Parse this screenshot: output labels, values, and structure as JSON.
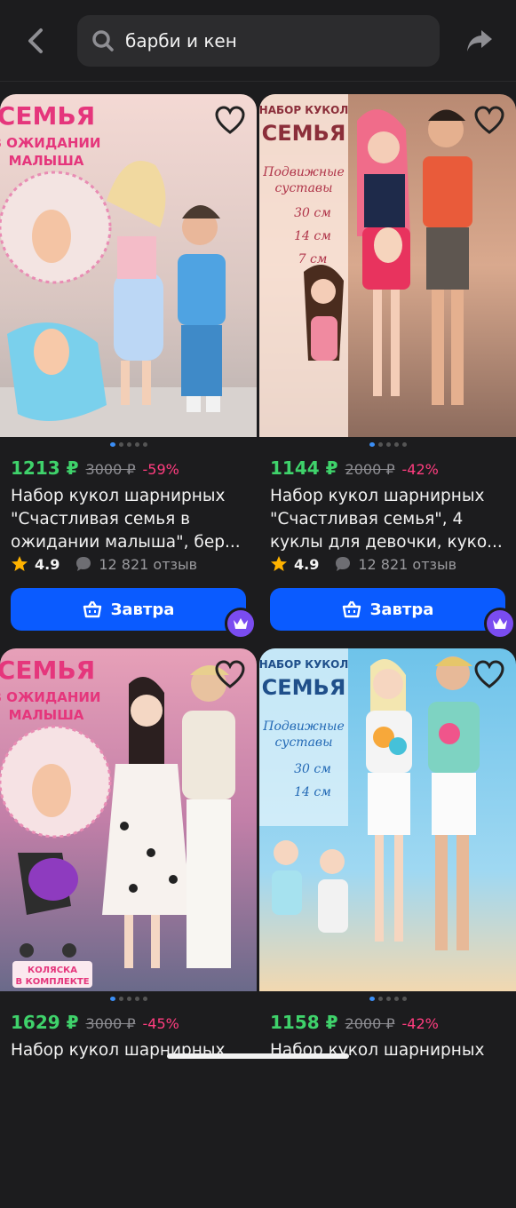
{
  "header": {
    "search_query": "барби и кен",
    "icons": [
      "back-arrow-icon",
      "search-icon",
      "share-icon"
    ]
  },
  "products": [
    {
      "price": "1213 ₽",
      "old_price": "3000 ₽",
      "discount": "-59%",
      "title": "Набор кукол шарнирных \"Счастливая семья в ожидании малыша\", бер...",
      "rating": "4.9",
      "reviews": "12 821 отзыв",
      "button": "Завтра",
      "image_text": [
        "СЕМЬЯ",
        "В ОЖИДАНИИ",
        "МАЛЫША"
      ]
    },
    {
      "price": "1144 ₽",
      "old_price": "2000 ₽",
      "discount": "-42%",
      "title": "Набор кукол шарнирных \"Счастливая семья\", 4 куклы для девочки, куко...",
      "rating": "4.9",
      "reviews": "12 821 отзыв",
      "button": "Завтра",
      "image_text": [
        "НАБОР КУКОЛ",
        "СЕМЬЯ",
        "Подвижные",
        "суставы",
        "30 см",
        "14 см",
        "7 см"
      ]
    },
    {
      "price": "1629 ₽",
      "old_price": "3000 ₽",
      "discount": "-45%",
      "title": "Набор кукол шарнирных",
      "image_text": [
        "СЕМЬЯ",
        "В ОЖИДАНИИ",
        "МАЛЫША",
        "КОЛЯСКА",
        "В КОМПЛЕКТЕ"
      ]
    },
    {
      "price": "1158 ₽",
      "old_price": "2000 ₽",
      "discount": "-42%",
      "title": "Набор кукол шарнирных",
      "image_text": [
        "НАБОР КУКОЛ",
        "СЕМЬЯ",
        "Подвижные",
        "суставы",
        "30 см",
        "14 см"
      ]
    }
  ],
  "colors": {
    "background": "#1c1c1e",
    "price": "#3fd26b",
    "discount": "#ff3d7f",
    "button": "#0a5bff",
    "badge": "#7a4cf0"
  }
}
